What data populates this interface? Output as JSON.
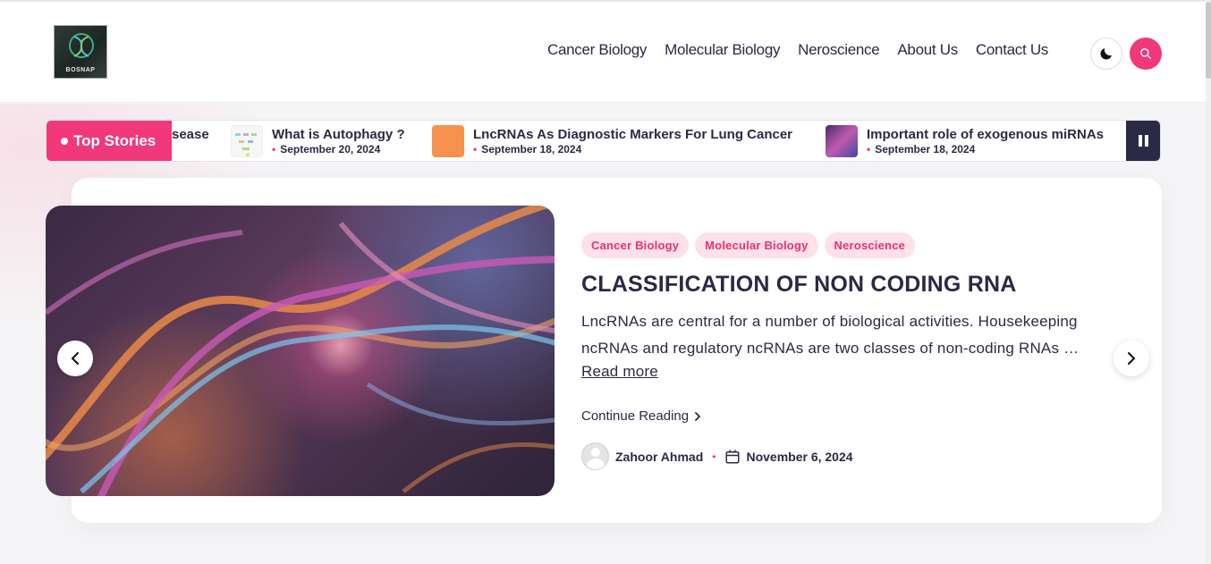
{
  "site": {
    "logo_text": "BOSNAP"
  },
  "nav": {
    "items": [
      "Cancer Biology",
      "Molecular Biology",
      "Neroscience",
      "About Us",
      "Contact Us"
    ]
  },
  "header_icons": {
    "theme_toggle": "moon-icon",
    "search": "search-icon",
    "accent_color": "#f0387a"
  },
  "ticker": {
    "label": "Top Stories",
    "partial_text": "sease",
    "stories": [
      {
        "title": "What is Autophagy ?",
        "date": "September 20, 2024"
      },
      {
        "title": "LncRNAs As Diagnostic Markers For Lung Cancer",
        "date": "September 18, 2024"
      },
      {
        "title": "Important role of exogenous miRNAs",
        "date": "September 18, 2024"
      }
    ]
  },
  "featured": {
    "categories": [
      "Cancer Biology",
      "Molecular Biology",
      "Neroscience"
    ],
    "title": "CLASSIFICATION OF NON CODING RNA",
    "excerpt": "LncRNAs are central for a number of biological activities. Housekeeping ncRNAs and regulatory ncRNAs are two classes of non-coding RNAs …",
    "read_more": "Read more",
    "continue_reading": "Continue Reading",
    "author": "Zahoor Ahmad",
    "date": "November 6, 2024"
  }
}
